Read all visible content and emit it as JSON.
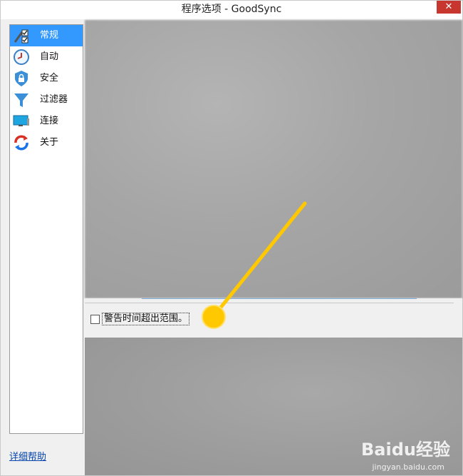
{
  "window": {
    "title": "程序选项 - GoodSync",
    "close_glyph": "✕"
  },
  "sidebar": {
    "items": [
      {
        "label": "常规",
        "icon": "general-settings-icon",
        "active": true
      },
      {
        "label": "自动",
        "icon": "clock-icon",
        "active": false
      },
      {
        "label": "安全",
        "icon": "shield-lock-icon",
        "active": false
      },
      {
        "label": "过滤器",
        "icon": "funnel-icon",
        "active": false
      },
      {
        "label": "连接",
        "icon": "monitor-icon",
        "active": false
      },
      {
        "label": "关于",
        "icon": "sync-icon",
        "active": false
      }
    ]
  },
  "help_link": "详细帮助",
  "options": {
    "warn_time_out_of_range": {
      "label": "警告时间超出范围。",
      "checked": false
    }
  },
  "watermark": {
    "brand": "Baidu经验",
    "url": "jingyan.baidu.com"
  },
  "colors": {
    "selection": "#3399ff",
    "annotation": "#ffc800",
    "close": "#c7372f"
  }
}
